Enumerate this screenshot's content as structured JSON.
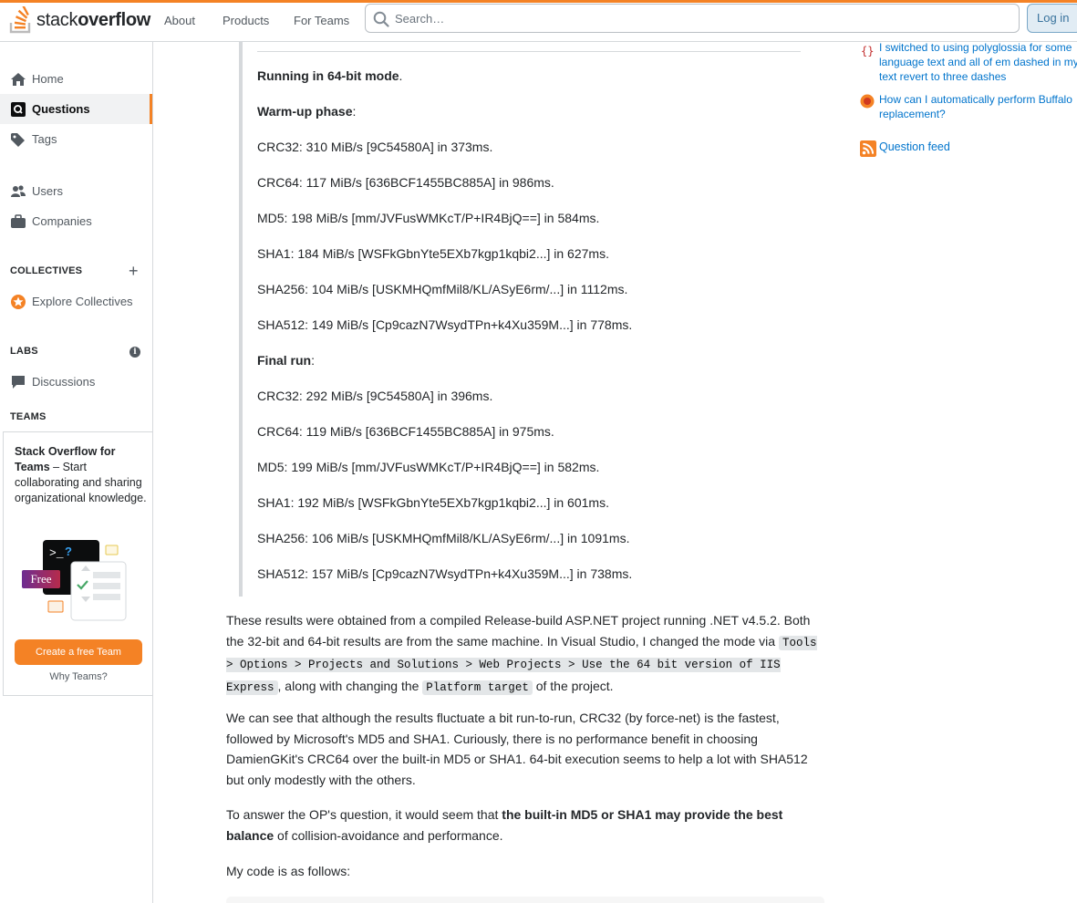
{
  "header": {
    "logo_text_light": "stack",
    "logo_text_bold": "overflow",
    "nav": [
      "About",
      "Products",
      "For Teams"
    ],
    "search_placeholder": "Search…",
    "login_label": "Log in"
  },
  "sidebar": {
    "home": "Home",
    "questions": "Questions",
    "tags": "Tags",
    "users": "Users",
    "companies": "Companies",
    "collectives_heading": "COLLECTIVES",
    "explore_collectives": "Explore Collectives",
    "labs_heading": "LABS",
    "discussions": "Discussions",
    "teams_heading": "TEAMS",
    "teams_title_bold": "Stack Overflow for Teams",
    "teams_title_rest": " – Start collaborating and sharing organizational knowledge.",
    "free_badge": "Free",
    "create_team": "Create a free Team",
    "why_teams": "Why Teams?"
  },
  "quote": {
    "mode_bold": "Running in 64-bit mode",
    "mode_rest": ".",
    "warmup_bold": "Warm-up phase",
    "warmup_rest": ":",
    "warmup_lines": [
      "CRC32: 310 MiB/s [9C54580A] in 373ms.",
      "CRC64: 117 MiB/s [636BCF1455BC885A] in 986ms.",
      "MD5: 198 MiB/s [mm/JVFusWMKcT/P+IR4BjQ==] in 584ms.",
      "SHA1: 184 MiB/s [WSFkGbnYte5EXb7kgp1kqbi2...] in 627ms.",
      "SHA256: 104 MiB/s [USKMHQmfMil8/KL/ASyE6rm/...] in 1112ms.",
      "SHA512: 149 MiB/s [Cp9cazN7WsydTPn+k4Xu359M...] in 778ms."
    ],
    "final_bold": "Final run",
    "final_rest": ":",
    "final_lines": [
      "CRC32: 292 MiB/s [9C54580A] in 396ms.",
      "CRC64: 119 MiB/s [636BCF1455BC885A] in 975ms.",
      "MD5: 199 MiB/s [mm/JVFusWMKcT/P+IR4BjQ==] in 582ms.",
      "SHA1: 192 MiB/s [WSFkGbnYte5EXb7kgp1kqbi2...] in 601ms.",
      "SHA256: 106 MiB/s [USKMHQmfMil8/KL/ASyE6rm/...] in 1091ms.",
      "SHA512: 157 MiB/s [Cp9cazN7WsydTPn+k4Xu359M...] in 738ms."
    ]
  },
  "body": {
    "p1_a": "These results were obtained from a compiled Release-build ASP.NET project running .NET v4.5.2. Both the 32-bit and 64-bit results are from the same machine. In Visual Studio, I changed the mode via ",
    "p1_code1": "Tools > Options > Projects and Solutions > Web Projects > Use the 64 bit version of IIS Express",
    "p1_b": ", along with changing the ",
    "p1_code2": "Platform target",
    "p1_c": " of the project.",
    "p2": "We can see that although the results fluctuate a bit run-to-run, CRC32 (by force-net) is the fastest, followed by Microsoft's MD5 and SHA1. Curiously, there is no performance benefit in choosing DamienGKit's CRC64 over the built-in MD5 or SHA1. 64-bit execution seems to help a lot with SHA512 but only modestly with the others.",
    "p3_a": "To answer the OP's question, it would seem that ",
    "p3_bold": "the built-in MD5 or SHA1 may provide the best balance",
    "p3_b": " of collision-avoidance and performance.",
    "p4": "My code is as follows:"
  },
  "right": {
    "hnq": [
      "I switched to using polyglossia for some language text and all of em dashed in my text revert to three dashes",
      "How can I automatically perform Buffalo replacement?"
    ],
    "question_feed": "Question feed"
  },
  "colors": {
    "accent": "#f48225",
    "link": "#0074cc",
    "free_badge": "#8c2b6d"
  }
}
